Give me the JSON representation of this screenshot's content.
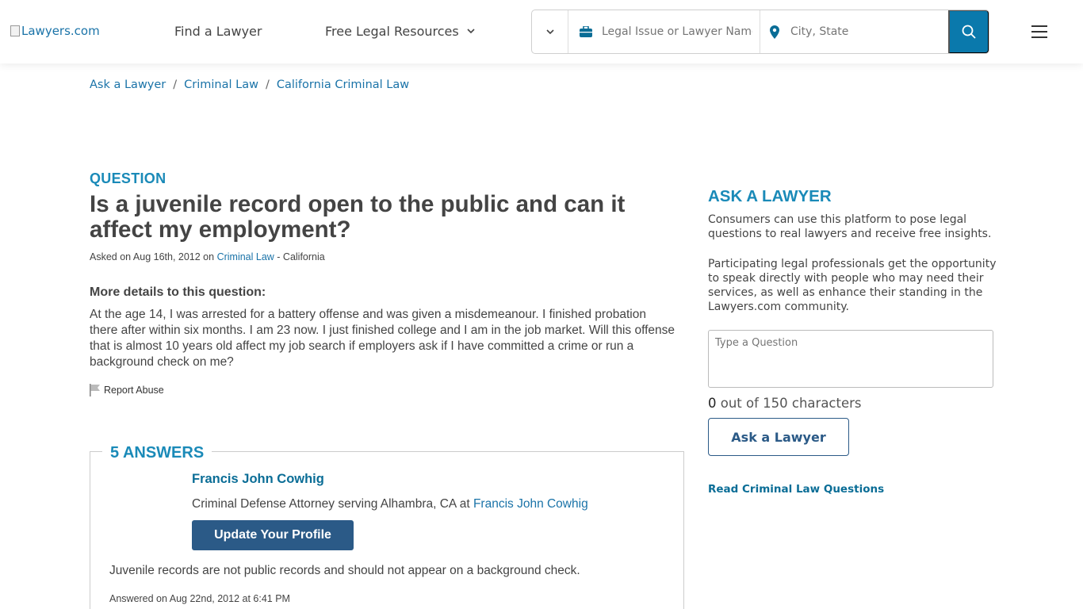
{
  "header": {
    "logo_alt": "Lawyers.com",
    "nav": {
      "find_lawyer": "Find a Lawyer",
      "free_resources": "Free Legal Resources"
    },
    "search": {
      "issue_placeholder": "Legal Issue or Lawyer Name",
      "location_placeholder": "City, State"
    }
  },
  "breadcrumb": [
    "Ask a Lawyer",
    "Criminal Law",
    "California Criminal Law"
  ],
  "question": {
    "label": "QUESTION",
    "title": "Is a juvenile record open to the public and can it affect my employment?",
    "asked_prefix": "Asked on Aug 16th, 2012 on",
    "category": "Criminal Law",
    "asked_suffix": " - California",
    "details_heading": "More details to this question:",
    "details": "At the age 14, I was arrested for a battery offense and was given a misdemeanour. I finished probation there after within six months. I am 23 now. I just finished college and I am in the job market. Will this offense that is almost 10 years old affect my job search if employers ask if I have committed a crime or run a background check on me?",
    "report_abuse": "Report Abuse"
  },
  "answers": {
    "heading": "5 ANSWERS",
    "first": {
      "lawyer_name": "Francis John Cowhig",
      "description_prefix": "Criminal Defense Attorney serving Alhambra, CA at",
      "firm_link": "Francis John Cowhig",
      "update_button": "Update Your Profile",
      "text": "Juvenile records are not public records and should not appear on a background check.",
      "answered_on": "Answered on Aug 22nd, 2012 at 6:41 PM"
    }
  },
  "sidebar": {
    "heading": "ASK A LAWYER",
    "para1": "Consumers can use this platform to pose legal questions to real lawyers and receive free insights.",
    "para2": "Participating legal professionals get the opportunity to speak directly with people who may need their services, as well as enhance their standing in the Lawyers.com community.",
    "question_placeholder": "Type a Question",
    "char_count": "0",
    "char_suffix": " out of 150 characters",
    "ask_button": "Ask a Lawyer",
    "read_link": "Read Criminal Law Questions"
  },
  "colors": {
    "accent": "#1a8ab8",
    "link": "#1a73a8",
    "button_primary": "#2b5a87",
    "search_button": "#0a79ac"
  }
}
